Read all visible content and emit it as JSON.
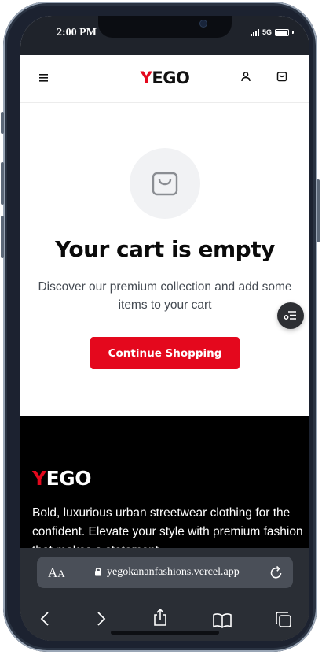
{
  "status_bar": {
    "time": "2:00 PM",
    "network": "5G"
  },
  "header": {
    "logo_first": "Y",
    "logo_rest": "EGO"
  },
  "cart": {
    "title": "Your cart is empty",
    "description": "Discover our premium collection and add some items to your cart",
    "cta_label": "Continue Shopping"
  },
  "footer": {
    "logo_first": "Y",
    "logo_rest": "EGO",
    "text": "Bold, luxurious urban streetwear clothing for the confident. Elevate your style with premium fashion that makes a statement."
  },
  "safari": {
    "aa_label_big": "A",
    "aa_label_small": "A",
    "url": "yegokananfashions.vercel.app"
  },
  "colors": {
    "brand_red": "#e4081d",
    "footer_bg": "#000000",
    "safari_bar": "#2a2e35",
    "frame": "#1c2230"
  },
  "icons": {
    "header": [
      "hamburger-menu-icon",
      "user-icon",
      "shopping-bag-icon"
    ],
    "toolbar": [
      "back-arrow-icon",
      "forward-arrow-icon",
      "share-icon",
      "bookmarks-icon",
      "tabs-icon"
    ]
  }
}
